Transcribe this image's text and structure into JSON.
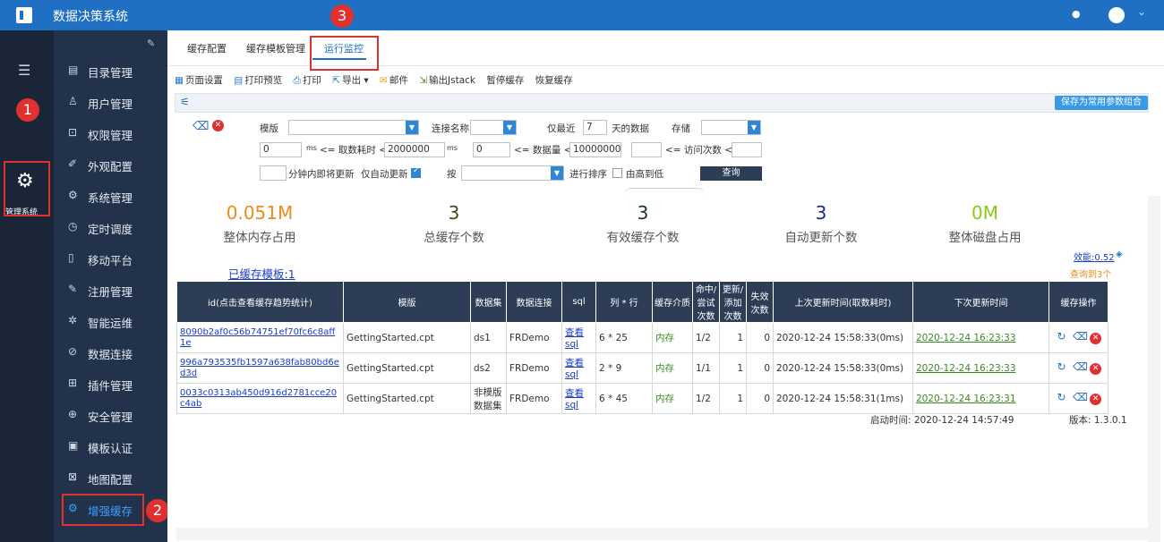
{
  "app": {
    "title": "数据决策系统"
  },
  "rail": {
    "system_label": "管理系统"
  },
  "nav": {
    "items": [
      {
        "label": "目录管理",
        "icon": "list-icon"
      },
      {
        "label": "用户管理",
        "icon": "user-icon"
      },
      {
        "label": "权限管理",
        "icon": "lock-icon"
      },
      {
        "label": "外观配置",
        "icon": "brush-icon"
      },
      {
        "label": "系统管理",
        "icon": "gear-icon"
      },
      {
        "label": "定时调度",
        "icon": "clock-icon"
      },
      {
        "label": "移动平台",
        "icon": "phone-icon"
      },
      {
        "label": "注册管理",
        "icon": "register-icon"
      },
      {
        "label": "智能运维",
        "icon": "ops-icon"
      },
      {
        "label": "数据连接",
        "icon": "link-icon"
      },
      {
        "label": "插件管理",
        "icon": "puzzle-icon"
      },
      {
        "label": "安全管理",
        "icon": "shield-icon"
      },
      {
        "label": "模板认证",
        "icon": "cert-icon"
      },
      {
        "label": "地图配置",
        "icon": "map-icon"
      },
      {
        "label": "增强缓存",
        "icon": "cache-icon"
      }
    ]
  },
  "annotations": [
    "1",
    "2",
    "3"
  ],
  "tabs": [
    "缓存配置",
    "缓存模板管理",
    "运行监控"
  ],
  "toolbar": [
    "页面设置",
    "打印预览",
    "打印",
    "导出",
    "邮件",
    "输出Jstack",
    "暂停缓存",
    "恢复缓存"
  ],
  "filters": {
    "save_param": "保存为常用参数组合",
    "template_label": "模版",
    "conn_label": "连接名称",
    "recent_label": "仅最近",
    "recent_value": "7",
    "days_label": "天的数据",
    "storage_label": "存储",
    "ms_min": "0",
    "ms_unit": "ms",
    "fetch_label": "<= 取数耗时 <=",
    "ms_max": "2000000",
    "rows_min": "0",
    "rows_label": "<= 数据量 <=",
    "rows_max": "10000000",
    "visit_min": "",
    "visit_label": "<= 访问次数 <=",
    "visit_max": "",
    "minutes_label": "分钟内即将更新",
    "auto_label": "仅自动更新",
    "by_label": "按",
    "sort_label": "进行排序",
    "desc_label": "由高到低",
    "query_label": "查询"
  },
  "stats": [
    {
      "value": "0.051M",
      "label": "整体内存占用",
      "color": "#f08a1c"
    },
    {
      "value": "3",
      "label": "总缓存个数",
      "color": "#3a4a20"
    },
    {
      "value": "3",
      "label": "有效缓存个数",
      "color": "#1a3a1a"
    },
    {
      "value": "3",
      "label": "自动更新个数",
      "color": "#1a2a8a"
    },
    {
      "value": "0M",
      "label": "整体磁盘占用",
      "color": "#8ac81a"
    }
  ],
  "cached_templates": "已缓存模板:1",
  "efficiency": "效能:0.52",
  "found": "查询到3个",
  "table": {
    "headers": [
      "id(点击查看缓存趋势统计)",
      "模版",
      "数据集",
      "数据连接",
      "sql",
      "列 * 行",
      "缓存介质",
      "命中/尝试次数",
      "更新/添加次数",
      "失效次数",
      "上次更新时间(取数耗时)",
      "下次更新时间",
      "缓存操作"
    ],
    "rows": [
      [
        "8090b2af0c56b74751ef70fc6c8aff1e",
        "GettingStarted.cpt",
        "ds1",
        "FRDemo",
        "查看sql",
        "6 * 25",
        "内存",
        "1/2",
        "1",
        "0",
        "2020-12-24 15:58:33(0ms)",
        "2020-12-24 16:23:33"
      ],
      [
        "996a793535fb1597a638fab80bd6ed3d",
        "GettingStarted.cpt",
        "ds2",
        "FRDemo",
        "查看sql",
        "2 * 9",
        "内存",
        "1/1",
        "1",
        "0",
        "2020-12-24 15:58:33(0ms)",
        "2020-12-24 16:23:33"
      ],
      [
        "0033c0313ab450d916d2781cce20c4ab",
        "GettingStarted.cpt",
        "非模版数据集",
        "FRDemo",
        "查看sql",
        "6 * 45",
        "内存",
        "1/2",
        "1",
        "0",
        "2020-12-24 15:58:31(1ms)",
        "2020-12-24 16:23:31"
      ]
    ]
  },
  "footer": {
    "start": "启动时间: 2020-12-24 14:57:49",
    "version": "版本: 1.3.0.1"
  }
}
